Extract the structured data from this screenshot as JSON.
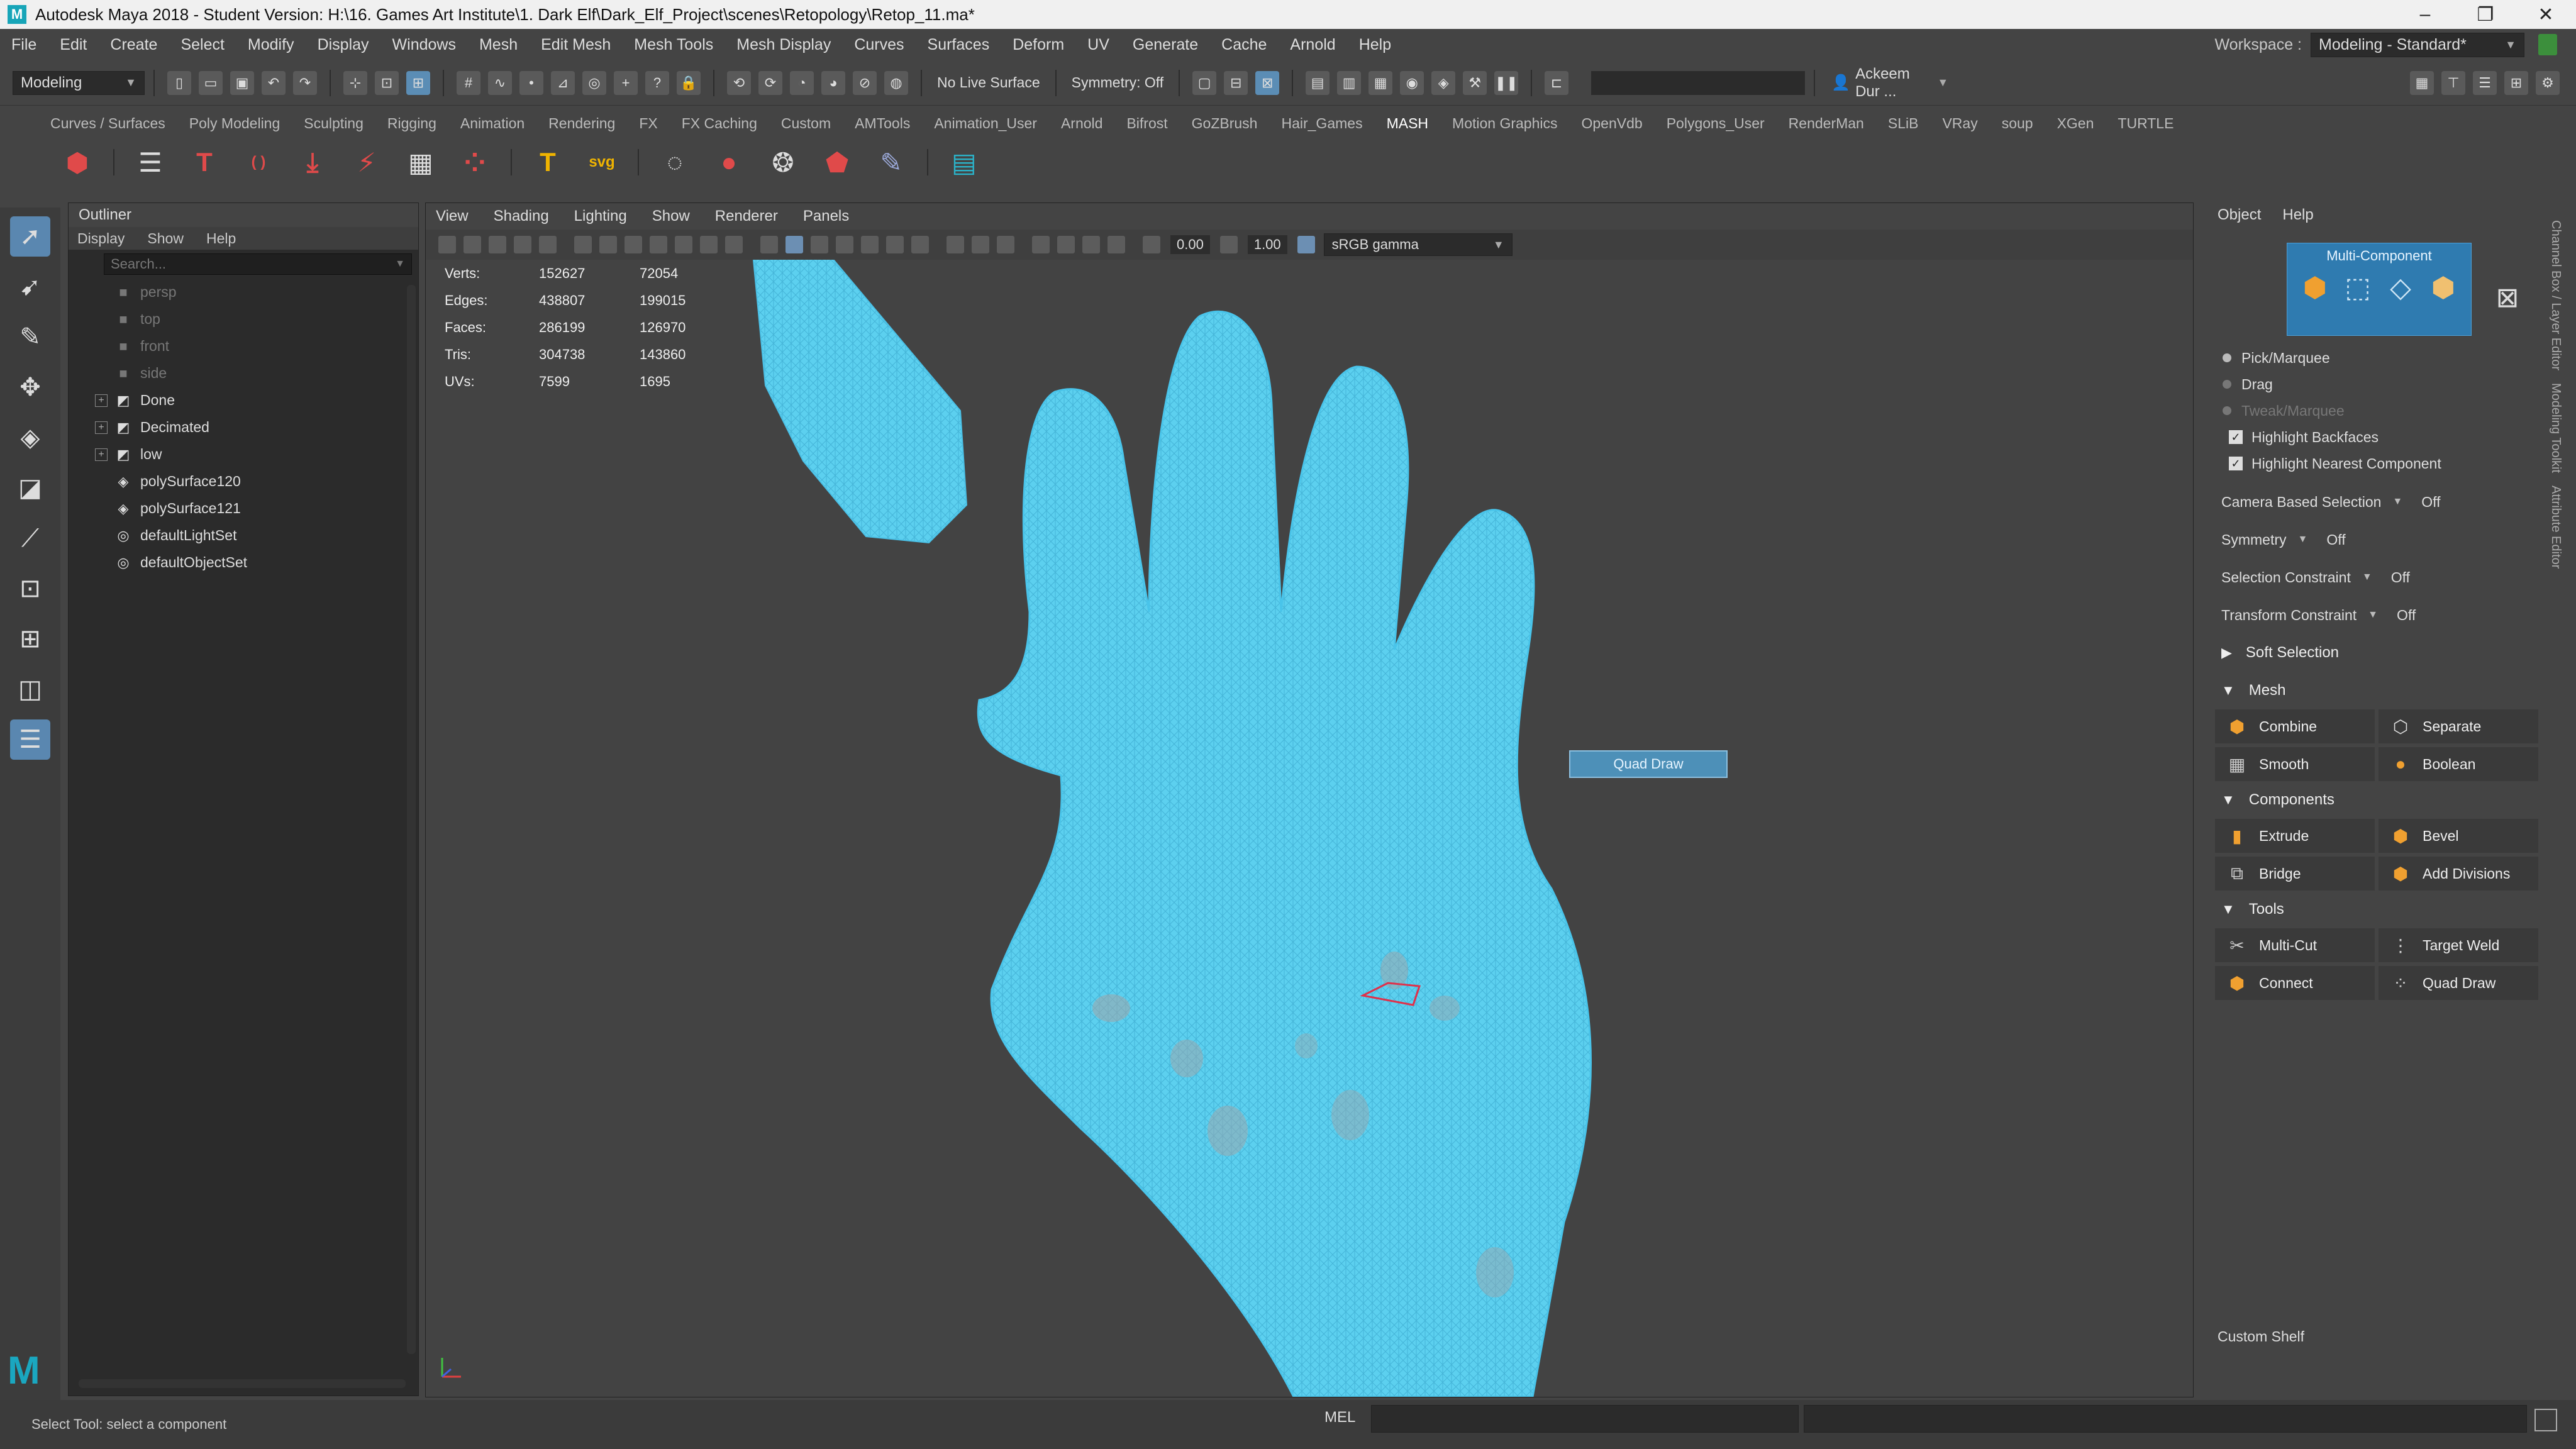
{
  "titlebar": {
    "title": "Autodesk Maya 2018 - Student Version: H:\\16. Games Art Institute\\1. Dark Elf\\Dark_Elf_Project\\scenes\\Retopology\\Retop_11.ma*",
    "minimize": "–",
    "restore": "❐",
    "close": "✕"
  },
  "menubar": {
    "items": [
      "File",
      "Edit",
      "Create",
      "Select",
      "Modify",
      "Display",
      "Windows",
      "Mesh",
      "Edit Mesh",
      "Mesh Tools",
      "Mesh Display",
      "Curves",
      "Surfaces",
      "Deform",
      "UV",
      "Generate",
      "Cache",
      "Arnold",
      "Help"
    ],
    "workspace_label": "Workspace :",
    "workspace_value": "Modeling - Standard*"
  },
  "statusline": {
    "mode": "Modeling",
    "live_surface": "No Live Surface",
    "symmetry": "Symmetry: Off",
    "user": "Ackeem Dur ..."
  },
  "shelf": {
    "tabs": [
      "Curves / Surfaces",
      "Poly Modeling",
      "Sculpting",
      "Rigging",
      "Animation",
      "Rendering",
      "FX",
      "FX Caching",
      "Custom",
      "AMTools",
      "Animation_User",
      "Arnold",
      "Bifrost",
      "GoZBrush",
      "Hair_Games",
      "MASH",
      "Motion Graphics",
      "OpenVdb",
      "Polygons_User",
      "RenderMan",
      "SLiB",
      "VRay",
      "soup",
      "XGen",
      "TURTLE"
    ],
    "active_tab": "MASH",
    "icons": [
      {
        "name": "mash-network-icon",
        "glyph": "⬢",
        "color": "#e04a4a"
      },
      {
        "name": "list-icon",
        "glyph": "☰",
        "color": "#dddddd"
      },
      {
        "name": "text-t-icon",
        "glyph": "T",
        "color": "#e04a4a"
      },
      {
        "name": "curve-icon",
        "glyph": "( )",
        "color": "#e04a4a"
      },
      {
        "name": "drop-icon",
        "glyph": "⤓",
        "color": "#e04a4a"
      },
      {
        "name": "scatter-icon",
        "glyph": "⚡",
        "color": "#e04a4a"
      },
      {
        "name": "grid-icon",
        "glyph": "▦",
        "color": "#dddddd"
      },
      {
        "name": "points-icon",
        "glyph": "⁘",
        "color": "#e04a4a"
      },
      {
        "name": "type-icon",
        "glyph": "T",
        "color": "#f0b400"
      },
      {
        "name": "svg-icon",
        "glyph": "svg",
        "color": "#f0b400"
      },
      {
        "name": "ring-icon",
        "glyph": "◌",
        "color": "#dddddd"
      },
      {
        "name": "sphere-icon",
        "glyph": "●",
        "color": "#e04a4a"
      },
      {
        "name": "balls-icon",
        "glyph": "❂",
        "color": "#dddddd"
      },
      {
        "name": "pin-icon",
        "glyph": "⬟",
        "color": "#e04a4a"
      },
      {
        "name": "brush-icon",
        "glyph": "✎",
        "color": "#9aa8d8"
      },
      {
        "name": "document-icon",
        "glyph": "▤",
        "color": "#2bb3c9"
      }
    ]
  },
  "outliner": {
    "title": "Outliner",
    "menu": [
      "Display",
      "Show",
      "Help"
    ],
    "search_placeholder": "Search...",
    "items": [
      {
        "label": "persp",
        "icon": "■",
        "dim": true,
        "expand": false
      },
      {
        "label": "top",
        "icon": "■",
        "dim": true,
        "expand": false
      },
      {
        "label": "front",
        "icon": "■",
        "dim": true,
        "expand": false
      },
      {
        "label": "side",
        "icon": "■",
        "dim": true,
        "expand": false
      },
      {
        "label": "Done",
        "icon": "◩",
        "dim": false,
        "expand": true
      },
      {
        "label": "Decimated",
        "icon": "◩",
        "dim": false,
        "expand": true
      },
      {
        "label": "low",
        "icon": "◩",
        "dim": false,
        "expand": true
      },
      {
        "label": "polySurface120",
        "icon": "◈",
        "dim": false,
        "expand": false
      },
      {
        "label": "polySurface121",
        "icon": "◈",
        "dim": false,
        "expand": false
      },
      {
        "label": "defaultLightSet",
        "icon": "◎",
        "dim": false,
        "expand": false
      },
      {
        "label": "defaultObjectSet",
        "icon": "◎",
        "dim": false,
        "expand": false
      }
    ]
  },
  "viewport": {
    "menu": [
      "View",
      "Shading",
      "Lighting",
      "Show",
      "Renderer",
      "Panels"
    ],
    "field_a": "0.00",
    "field_b": "1.00",
    "color_space": "sRGB gamma",
    "hud": [
      {
        "k": "Verts:",
        "v1": "152627",
        "v2": "72054"
      },
      {
        "k": "Edges:",
        "v1": "438807",
        "v2": "199015"
      },
      {
        "k": "Faces:",
        "v1": "286199",
        "v2": "126970"
      },
      {
        "k": "Tris:",
        "v1": "304738",
        "v2": "143860"
      },
      {
        "k": "UVs:",
        "v1": "7599",
        "v2": "1695"
      }
    ],
    "tooltip": "Quad Draw",
    "mesh_color": "#5fd0f0"
  },
  "rightpanel": {
    "menu": [
      "Object",
      "Help"
    ],
    "multicomp_title": "Multi-Component",
    "mc_icons": [
      {
        "name": "object-mode-icon",
        "glyph": "⬢",
        "color": "#f0a030"
      },
      {
        "name": "edge-mode-icon",
        "glyph": "⬚",
        "color": "#cfe6f5"
      },
      {
        "name": "face-mode-icon",
        "glyph": "◇",
        "color": "#cfe6f5"
      },
      {
        "name": "uv-mode-icon",
        "glyph": "⬢",
        "color": "#f0c070"
      },
      {
        "name": "vertex-mode-icon",
        "glyph": "⊠",
        "color": "#dddddd"
      }
    ],
    "radio_options": [
      {
        "label": "Pick/Marquee",
        "on": true,
        "dim": false
      },
      {
        "label": "Drag",
        "on": false,
        "dim": false
      },
      {
        "label": "Tweak/Marquee",
        "on": false,
        "dim": true
      }
    ],
    "check_options": [
      "Highlight Backfaces",
      "Highlight Nearest Component"
    ],
    "props": [
      {
        "label": "Camera Based Selection",
        "value": "Off"
      },
      {
        "label": "Symmetry",
        "value": "Off"
      },
      {
        "label": "Selection Constraint",
        "value": "Off"
      },
      {
        "label": "Transform Constraint",
        "value": "Off"
      }
    ],
    "soft_selection": "Soft Selection",
    "sections": [
      {
        "title": "Mesh",
        "buttons": [
          {
            "label": "Combine",
            "icon": "⬢",
            "color": "#f0a030"
          },
          {
            "label": "Separate",
            "icon": "⬡",
            "color": "#dddddd"
          },
          {
            "label": "Smooth",
            "icon": "▦",
            "color": "#cccccc"
          },
          {
            "label": "Boolean",
            "icon": "●",
            "color": "#f0a030"
          }
        ]
      },
      {
        "title": "Components",
        "buttons": [
          {
            "label": "Extrude",
            "icon": "▮",
            "color": "#f0a030"
          },
          {
            "label": "Bevel",
            "icon": "⬢",
            "color": "#f0a030"
          },
          {
            "label": "Bridge",
            "icon": "⧉",
            "color": "#cccccc"
          },
          {
            "label": "Add Divisions",
            "icon": "⬢",
            "color": "#f0a030"
          }
        ]
      },
      {
        "title": "Tools",
        "buttons": [
          {
            "label": "Multi-Cut",
            "icon": "✂",
            "color": "#cccccc"
          },
          {
            "label": "Target Weld",
            "icon": "⋮",
            "color": "#cccccc"
          },
          {
            "label": "Connect",
            "icon": "⬢",
            "color": "#f0a030"
          },
          {
            "label": "Quad Draw",
            "icon": "⁘",
            "color": "#cccccc"
          }
        ]
      }
    ],
    "custom_shelf": "Custom Shelf",
    "side_tabs": [
      "Channel Box / Layer Editor",
      "Modeling Toolkit",
      "Attribute Editor"
    ]
  },
  "helpline": {
    "text": "Select Tool: select a component",
    "mel": "MEL"
  }
}
